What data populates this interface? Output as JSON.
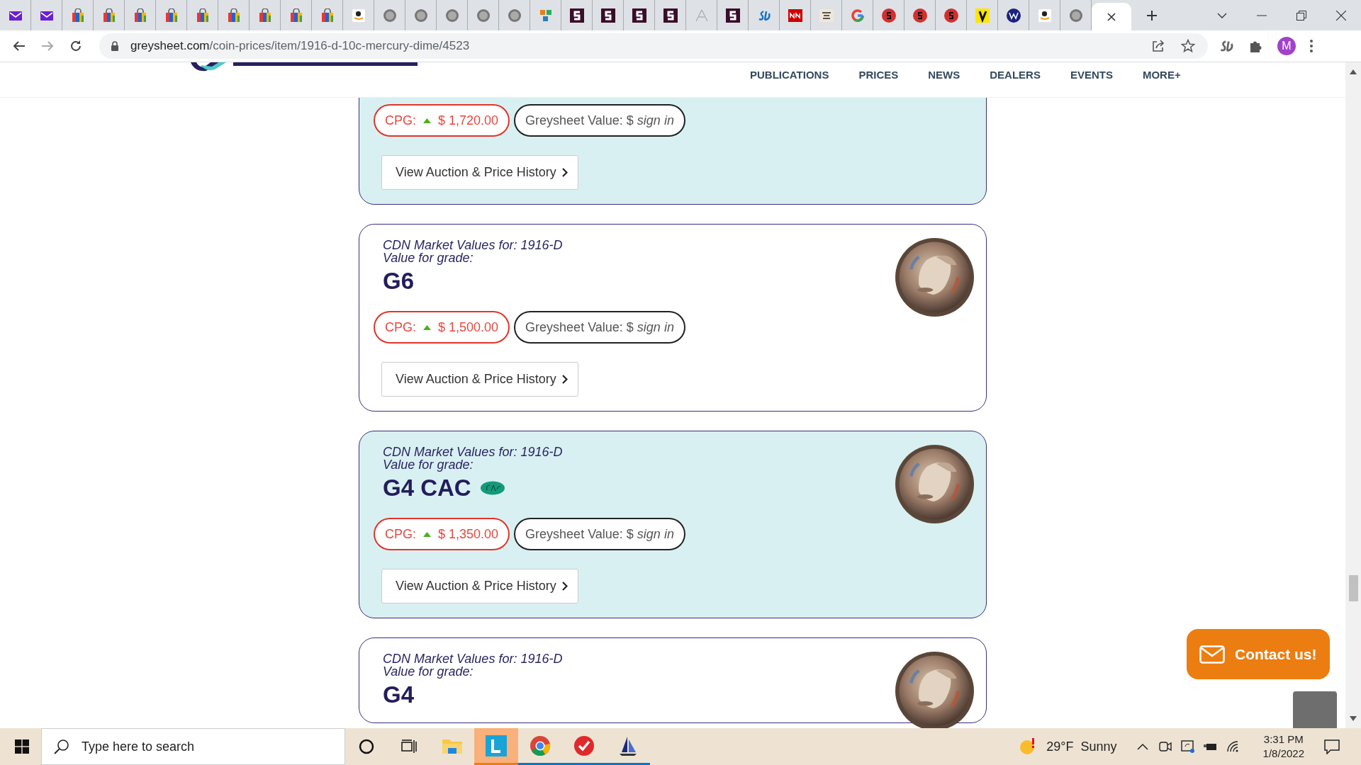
{
  "browser": {
    "tabs": [
      {
        "kind": "mail",
        "selected": false
      },
      {
        "kind": "mail",
        "selected": false
      },
      {
        "kind": "bag",
        "selected": false
      },
      {
        "kind": "bag",
        "selected": false
      },
      {
        "kind": "bag",
        "selected": false
      },
      {
        "kind": "bag",
        "selected": false
      },
      {
        "kind": "bag",
        "selected": false
      },
      {
        "kind": "bag",
        "selected": false
      },
      {
        "kind": "bag",
        "selected": false
      },
      {
        "kind": "bag",
        "selected": false
      },
      {
        "kind": "bag",
        "selected": false
      },
      {
        "kind": "smile",
        "selected": false
      },
      {
        "kind": "coin",
        "selected": false
      },
      {
        "kind": "coin",
        "selected": false
      },
      {
        "kind": "coin",
        "selected": false
      },
      {
        "kind": "coin",
        "selected": false
      },
      {
        "kind": "coin",
        "selected": false
      },
      {
        "kind": "cubes",
        "selected": false
      },
      {
        "kind": "s-square",
        "selected": false
      },
      {
        "kind": "s-square",
        "selected": false
      },
      {
        "kind": "s-square",
        "selected": false
      },
      {
        "kind": "s-square",
        "selected": false
      },
      {
        "kind": "peak",
        "selected": false
      },
      {
        "kind": "s-square",
        "selected": false
      },
      {
        "kind": "sd",
        "selected": false
      },
      {
        "kind": "news",
        "selected": false
      },
      {
        "kind": "book",
        "selected": false
      },
      {
        "kind": "ring",
        "selected": false
      },
      {
        "kind": "red-dot",
        "selected": false
      },
      {
        "kind": "red-dot",
        "selected": false
      },
      {
        "kind": "red-dot",
        "selected": false
      },
      {
        "kind": "yellow",
        "selected": false
      },
      {
        "kind": "navy-dot",
        "selected": false
      },
      {
        "kind": "smile",
        "selected": false
      },
      {
        "kind": "coin",
        "selected": false
      },
      {
        "kind": "blank",
        "selected": true
      }
    ],
    "url": {
      "host": "greysheet.com",
      "path": "/coin-prices/item/1916-d-10c-mercury-dime/4523"
    },
    "profile_initial": "M"
  },
  "site": {
    "nav": [
      "PUBLICATIONS",
      "PRICES",
      "NEWS",
      "DEALERS",
      "EVENTS",
      "MORE+"
    ],
    "cards": [
      {
        "highlighted": true,
        "cpg_label": "CPG:",
        "rising": true,
        "cpg_value": "$ 1,720.00",
        "gs_label": "Greysheet Value: $",
        "gs_link": "sign in",
        "history_button": "View Auction & Price History"
      },
      {
        "highlighted": false,
        "title": "CDN Market Values for: 1916-D",
        "subtitle": "Value for grade:",
        "grade": "G6",
        "cac": false,
        "cpg_label": "CPG:",
        "rising": true,
        "cpg_value": "$ 1,500.00",
        "gs_label": "Greysheet Value: $",
        "gs_link": "sign in",
        "history_button": "View Auction & Price History"
      },
      {
        "highlighted": true,
        "title": "CDN Market Values for: 1916-D",
        "subtitle": "Value for grade:",
        "grade": "G4 CAC",
        "cac": true,
        "cpg_label": "CPG:",
        "rising": true,
        "cpg_value": "$ 1,350.00",
        "gs_label": "Greysheet Value: $",
        "gs_link": "sign in",
        "history_button": "View Auction & Price History"
      },
      {
        "highlighted": false,
        "title": "CDN Market Values for: 1916-D",
        "subtitle": "Value for grade:",
        "grade": "G4",
        "cac": false
      }
    ],
    "contact_button": "Contact us!"
  },
  "taskbar": {
    "search_placeholder": "Type here to search",
    "apps": [
      {
        "kind": "folder",
        "running": false,
        "selected": false
      },
      {
        "kind": "letter-tile",
        "running": true,
        "selected": true
      },
      {
        "kind": "chrome",
        "running": true,
        "selected": false
      },
      {
        "kind": "check",
        "running": true,
        "selected": false
      },
      {
        "kind": "boat",
        "running": true,
        "selected": false
      }
    ],
    "weather": {
      "temp": "29°F",
      "condition": "Sunny"
    },
    "time": "3:31 PM",
    "date": "1/8/2022"
  }
}
